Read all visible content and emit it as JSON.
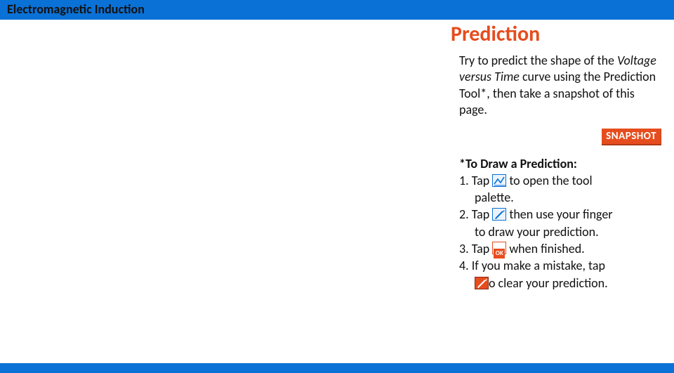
{
  "header": {
    "title": "Electromagnetic Induction"
  },
  "panel": {
    "title": "Prediction",
    "intro_1": "Try to predict the shape of the ",
    "intro_italic": "Voltage versus Time",
    "intro_2": " curve using the Prediction Tool*, then take a snapshot of this page.",
    "snapshot_label": "SNAPSHOT",
    "instr_heading": "*To Draw a Prediction:",
    "step1_a": "1. Tap ",
    "step1_b": " to open the tool",
    "step1_c": "palette.",
    "step2_a": "2. Tap ",
    "step2_b": " then use your finger",
    "step2_c": "to draw your prediction.",
    "step3_a": "3. Tap ",
    "step3_b": " when finished.",
    "step4_a": "4. If you make a mistake, tap",
    "step4_b": "o clear your prediction."
  },
  "icons": {
    "tool_palette": "chart-tool-icon",
    "pencil": "pencil-tool-icon",
    "ok": "ok-icon",
    "clear": "clear-pencil-icon"
  }
}
